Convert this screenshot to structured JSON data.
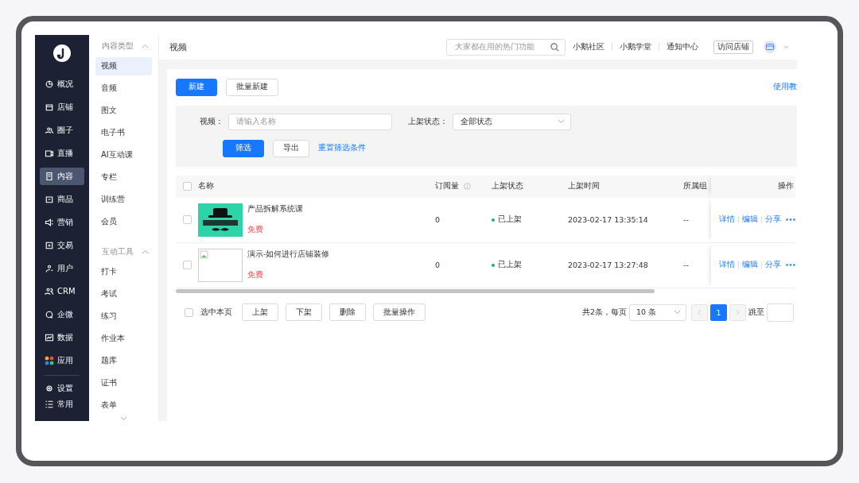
{
  "nav": {
    "items": [
      {
        "label": "概况",
        "selected": false
      },
      {
        "label": "店铺",
        "selected": false
      },
      {
        "label": "圈子",
        "selected": false
      },
      {
        "label": "直播",
        "selected": false
      },
      {
        "label": "内容",
        "selected": true
      },
      {
        "label": "商品",
        "selected": false
      },
      {
        "label": "营销",
        "selected": false
      },
      {
        "label": "交易",
        "selected": false
      },
      {
        "label": "用户",
        "selected": false
      },
      {
        "label": "CRM",
        "selected": false
      },
      {
        "label": "企微",
        "selected": false
      },
      {
        "label": "数据",
        "selected": false
      },
      {
        "label": "应用",
        "selected": false
      }
    ],
    "footer": [
      {
        "label": "设置"
      },
      {
        "label": "常用"
      }
    ]
  },
  "submenu": {
    "groups": [
      {
        "title": "内容类型",
        "expanded": true,
        "items": [
          {
            "label": "视频",
            "selected": true
          },
          {
            "label": "音频",
            "selected": false
          },
          {
            "label": "图文",
            "selected": false
          },
          {
            "label": "电子书",
            "selected": false
          },
          {
            "label": "AI互动课",
            "selected": false
          },
          {
            "label": "专栏",
            "selected": false
          },
          {
            "label": "训练营",
            "selected": false
          },
          {
            "label": "会员",
            "selected": false
          }
        ]
      },
      {
        "title": "互动工具",
        "expanded": true,
        "items": [
          {
            "label": "打卡",
            "selected": false
          },
          {
            "label": "考试",
            "selected": false
          },
          {
            "label": "练习",
            "selected": false
          },
          {
            "label": "作业本",
            "selected": false
          },
          {
            "label": "题库",
            "selected": false
          },
          {
            "label": "证书",
            "selected": false
          },
          {
            "label": "表单",
            "selected": false
          }
        ]
      }
    ]
  },
  "header": {
    "title": "视频",
    "search": {
      "placeholder": "大家都在用的热门功能"
    },
    "links": [
      "小鹅社区",
      "小鹅学堂",
      "通知中心"
    ],
    "visit_button": "访问店铺"
  },
  "toolbar": {
    "buttons": [
      {
        "label": "新建",
        "primary": true
      },
      {
        "label": "批量新建",
        "primary": false
      }
    ],
    "help_link": "使用教"
  },
  "filters": {
    "fields": [
      {
        "kind": "input",
        "label": "视频：",
        "placeholder": "请输入名称"
      },
      {
        "kind": "select",
        "label": "上架状态：",
        "value": "全部状态"
      }
    ],
    "buttons": [
      {
        "label": "筛选",
        "primary": true
      },
      {
        "label": "导出",
        "primary": false
      }
    ],
    "reset_link": "重置筛选条件"
  },
  "table": {
    "all_checked": false,
    "columns": [
      {
        "label": "名称",
        "info": false
      },
      {
        "label": "订阅量",
        "info": true
      },
      {
        "label": "上架状态",
        "info": false
      },
      {
        "label": "上架时间",
        "info": false
      },
      {
        "label": "所属组",
        "info": false
      },
      {
        "label": "操作",
        "info": false
      }
    ],
    "rows": [
      {
        "kind": "picture",
        "title": "产品拆解系统课",
        "price": "免费",
        "subscriptions": "0",
        "status": "已上架",
        "time": "2023-02-17 13:35:14",
        "group": "--",
        "actions": [
          "详情",
          "编辑",
          "分享"
        ],
        "checked": false
      },
      {
        "kind": "broken",
        "title": "演示-如何进行店铺装修",
        "price": "免费",
        "subscriptions": "0",
        "status": "已上架",
        "time": "2023-02-17 13:27:48",
        "group": "--",
        "actions": [
          "详情",
          "编辑",
          "分享"
        ],
        "checked": false
      }
    ]
  },
  "footer": {
    "select_page_checked": false,
    "select_page": "选中本页",
    "buttons": [
      "上架",
      "下架",
      "删除",
      "批量操作"
    ],
    "total": "共2条，每页",
    "page_size": "10 条",
    "pages": [
      {
        "label": "1",
        "selected": true
      }
    ],
    "jump": "跳至"
  }
}
